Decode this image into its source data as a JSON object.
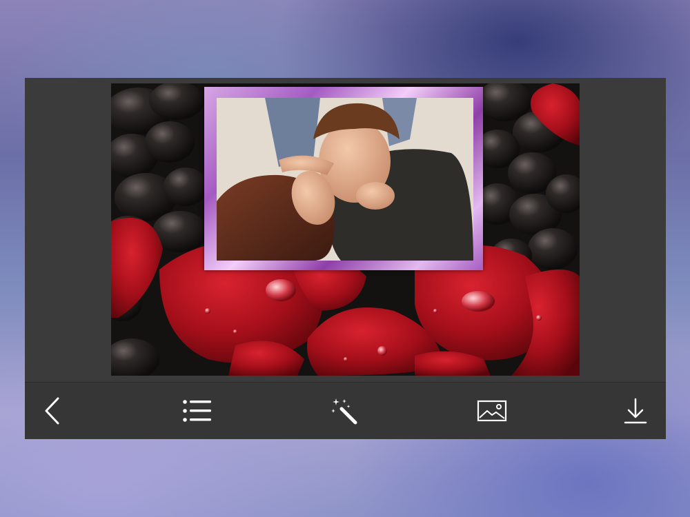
{
  "app": {
    "accent_color": "#ffffff",
    "toolbar_color": "#363636",
    "panel_color": "#3b3b3b"
  },
  "toolbar": {
    "items": [
      {
        "id": "back",
        "icon": "chevron-left-icon"
      },
      {
        "id": "menu",
        "icon": "list-icon"
      },
      {
        "id": "effects",
        "icon": "magic-wand-icon"
      },
      {
        "id": "gallery",
        "icon": "image-icon"
      },
      {
        "id": "save",
        "icon": "download-icon"
      }
    ]
  },
  "editor": {
    "frame_style": "purple-metallic-frame",
    "background_theme": "rose-petals-and-black-stones",
    "frame_color": "#b26ad0",
    "petal_color": "#b0121d"
  }
}
